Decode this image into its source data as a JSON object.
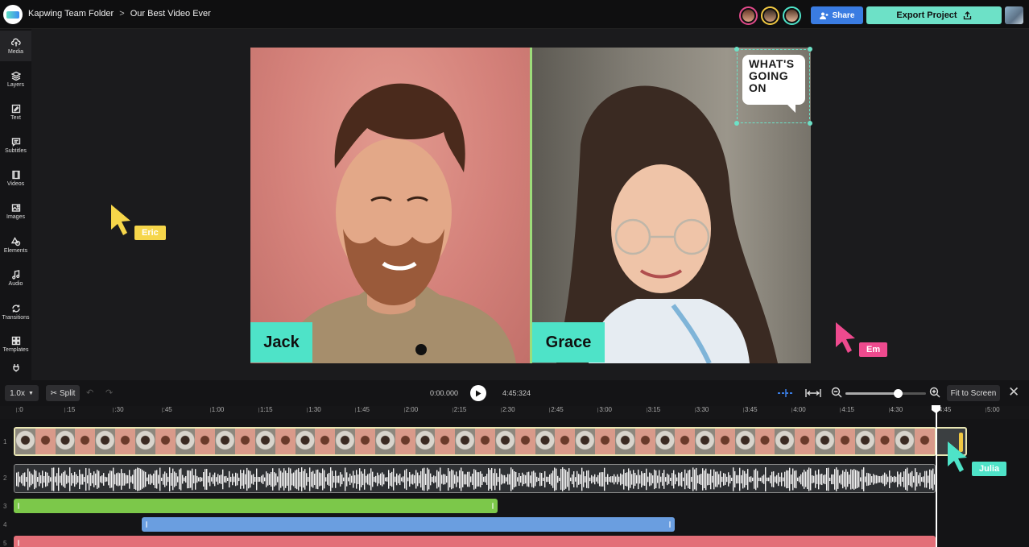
{
  "header": {
    "folder": "Kapwing Team Folder",
    "separator": ">",
    "project": "Our Best Video Ever",
    "share_label": "Share",
    "export_label": "Export Project",
    "collaborators": [
      {
        "icon": "avatar-1",
        "ring": "#e24a8a"
      },
      {
        "icon": "avatar-2",
        "ring": "#f1c842"
      },
      {
        "icon": "avatar-3",
        "ring": "#4ee3c8"
      }
    ]
  },
  "sidebar": {
    "items": [
      {
        "label": "Media",
        "icon": "upload-icon"
      },
      {
        "label": "Layers",
        "icon": "layers-icon"
      },
      {
        "label": "Text",
        "icon": "text-icon"
      },
      {
        "label": "Subtitles",
        "icon": "subtitles-icon"
      },
      {
        "label": "Videos",
        "icon": "videos-icon"
      },
      {
        "label": "Images",
        "icon": "images-icon"
      },
      {
        "label": "Elements",
        "icon": "elements-icon"
      },
      {
        "label": "Audio",
        "icon": "audio-icon"
      },
      {
        "label": "Transitions",
        "icon": "transitions-icon"
      },
      {
        "label": "Templates",
        "icon": "templates-icon"
      }
    ]
  },
  "canvas": {
    "left_name": "Jack",
    "right_name": "Grace",
    "bubble_lines": [
      "WHAT'S",
      "GOING",
      "ON"
    ],
    "cursors": [
      {
        "name": "Eric",
        "color": "#f6d64a"
      },
      {
        "name": "Em",
        "color": "#ee4a8e"
      },
      {
        "name": "Julia",
        "color": "#4ee3c8"
      }
    ]
  },
  "timeline": {
    "speed": "1.0x",
    "split_label": "Split",
    "current_time": "0:00.000",
    "total_time": "4:45:324",
    "fit_label": "Fit to Screen",
    "zoom_level": 0.65,
    "ruler": [
      ":0",
      ":15",
      ":30",
      ":45",
      "1:00",
      "1:15",
      "1:30",
      "1:45",
      "2:00",
      "2:15",
      "2:30",
      "2:45",
      "3:00",
      "3:15",
      "3:30",
      "3:45",
      "4:00",
      "4:15",
      "4:30",
      "4:45",
      "5:00"
    ],
    "track_numbers": [
      "1",
      "2",
      "3",
      "4",
      "5"
    ],
    "clip_colors": {
      "green": "#7cc84a",
      "blue": "#6a9ee0",
      "red": "#e36f78"
    }
  }
}
